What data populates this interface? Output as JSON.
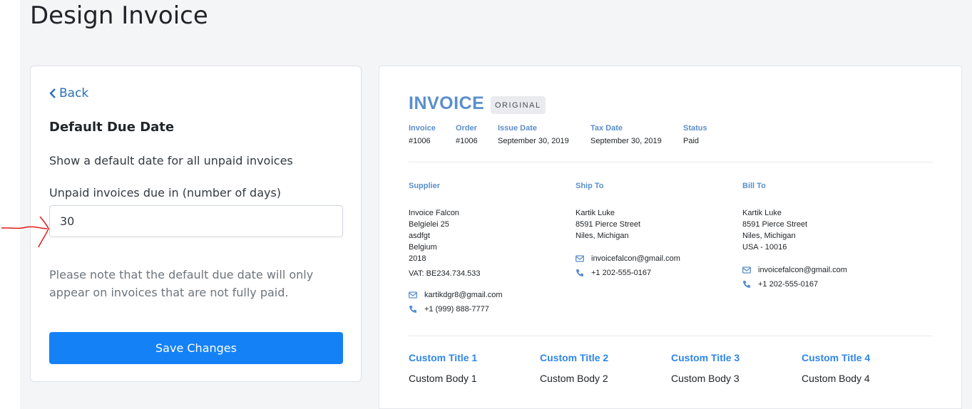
{
  "page": {
    "title": "Design Invoice"
  },
  "settings": {
    "back_label": "Back",
    "section_title": "Default Due Date",
    "description": "Show a default date for all unpaid invoices",
    "field_label": "Unpaid invoices due in (number of days)",
    "days_value": "30",
    "note": "Please note that the default due date will only appear on invoices that are not fully paid.",
    "save_label": "Save Changes"
  },
  "invoice": {
    "title": "INVOICE",
    "badge": "ORIGINAL",
    "meta": [
      {
        "label": "Invoice",
        "value": "#1006"
      },
      {
        "label": "Order",
        "value": "#1006"
      },
      {
        "label": "Issue Date",
        "value": "September 30, 2019"
      },
      {
        "label": "Tax Date",
        "value": "September 30, 2019"
      },
      {
        "label": "Status",
        "value": "Paid"
      }
    ],
    "supplier": {
      "heading": "Supplier",
      "lines": [
        "Invoice Falcon",
        "Belgielei 25",
        "asdfgt",
        "Belgium",
        "2018"
      ],
      "vat": "VAT: BE234.734.533",
      "email": "kartikdgr8@gmail.com",
      "phone": "+1 (999) 888-7777"
    },
    "ship_to": {
      "heading": "Ship To",
      "lines": [
        "Kartik Luke",
        "8591 Pierce Street",
        "Niles, Michigan"
      ],
      "email": "invoicefalcon@gmail.com",
      "phone": "+1 202-555-0167"
    },
    "bill_to": {
      "heading": "Bill To",
      "lines": [
        "Kartik Luke",
        "8591 Pierce Street",
        "Niles, Michigan",
        "USA - 10016"
      ],
      "email": "invoicefalcon@gmail.com",
      "phone": "+1 202-555-0167"
    },
    "custom": [
      {
        "title": "Custom Title 1",
        "body": "Custom Body 1"
      },
      {
        "title": "Custom Title 2",
        "body": "Custom Body 2"
      },
      {
        "title": "Custom Title 3",
        "body": "Custom Body 3"
      },
      {
        "title": "Custom Title 4",
        "body": "Custom Body 4"
      }
    ]
  },
  "colors": {
    "accent": "#5a8fcc",
    "link": "#2a6fb7",
    "button": "#1481f7",
    "custom_title": "#2f86e8",
    "annotation": "#e01b1b"
  },
  "icons": [
    "chevron-left-icon",
    "envelope-icon",
    "phone-icon",
    "red-arrow-annotation"
  ]
}
